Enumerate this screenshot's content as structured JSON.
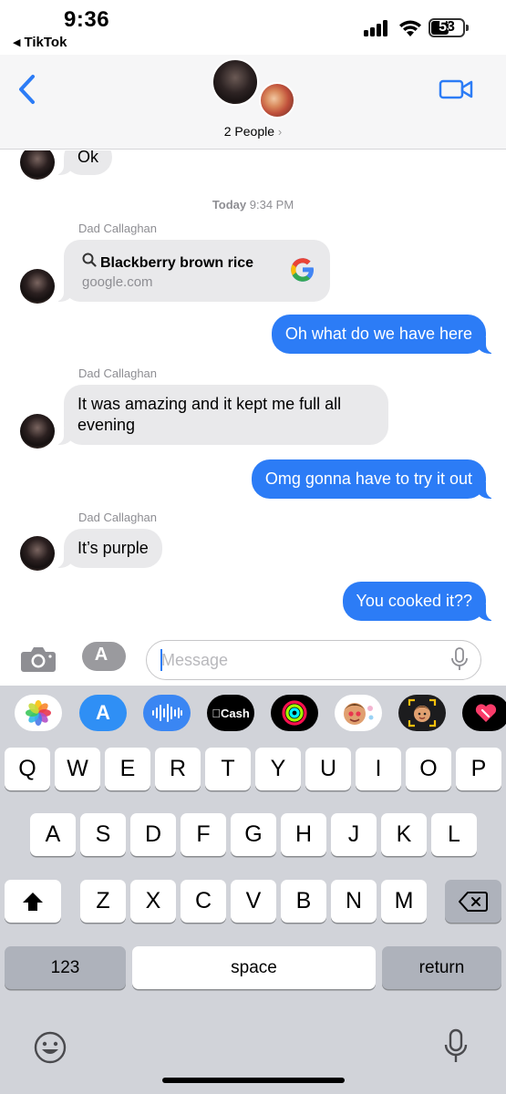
{
  "status_bar": {
    "time": "9:36",
    "back_app": "TikTok",
    "battery": "53"
  },
  "header": {
    "participants": "2 People",
    "back_icon": "chevron-left-icon",
    "video_icon": "video-camera-icon"
  },
  "thread": {
    "partial_message": "Ok",
    "timestamp_day": "Today",
    "timestamp_time": "9:34 PM",
    "messages": [
      {
        "sender": "Dad Callaghan",
        "link_title": "Blackberry brown rice",
        "link_url": "google.com"
      },
      {
        "text": "Oh what do we have here"
      },
      {
        "sender": "Dad Callaghan",
        "text": "It was amazing and it kept me full all evening"
      },
      {
        "text": "Omg gonna have to try it out"
      },
      {
        "sender": "Dad Callaghan",
        "text": "It’s purple"
      },
      {
        "text": "You cooked it??"
      }
    ]
  },
  "compose": {
    "placeholder": "Message"
  },
  "keyboard": {
    "app_strip": [
      {
        "name": "photos-app-icon"
      },
      {
        "name": "app-store-icon"
      },
      {
        "name": "audio-message-icon"
      },
      {
        "name": "apple-cash-icon",
        "label": "Cash"
      },
      {
        "name": "activity-icon"
      },
      {
        "name": "memoji-stickers-icon"
      },
      {
        "name": "memoji-icon"
      },
      {
        "name": "digital-touch-icon"
      }
    ],
    "row1": [
      "Q",
      "W",
      "E",
      "R",
      "T",
      "Y",
      "U",
      "I",
      "O",
      "P"
    ],
    "row2": [
      "A",
      "S",
      "D",
      "F",
      "G",
      "H",
      "J",
      "K",
      "L"
    ],
    "row3": [
      "Z",
      "X",
      "C",
      "V",
      "B",
      "N",
      "M"
    ],
    "numbers_label": "123",
    "space_label": "space",
    "return_label": "return"
  },
  "colors": {
    "outgoing_bubble": "#2c7cf6",
    "incoming_bubble": "#e9e9eb",
    "accent": "#2c7cf6",
    "keyboard_bg": "#d1d3d9"
  }
}
